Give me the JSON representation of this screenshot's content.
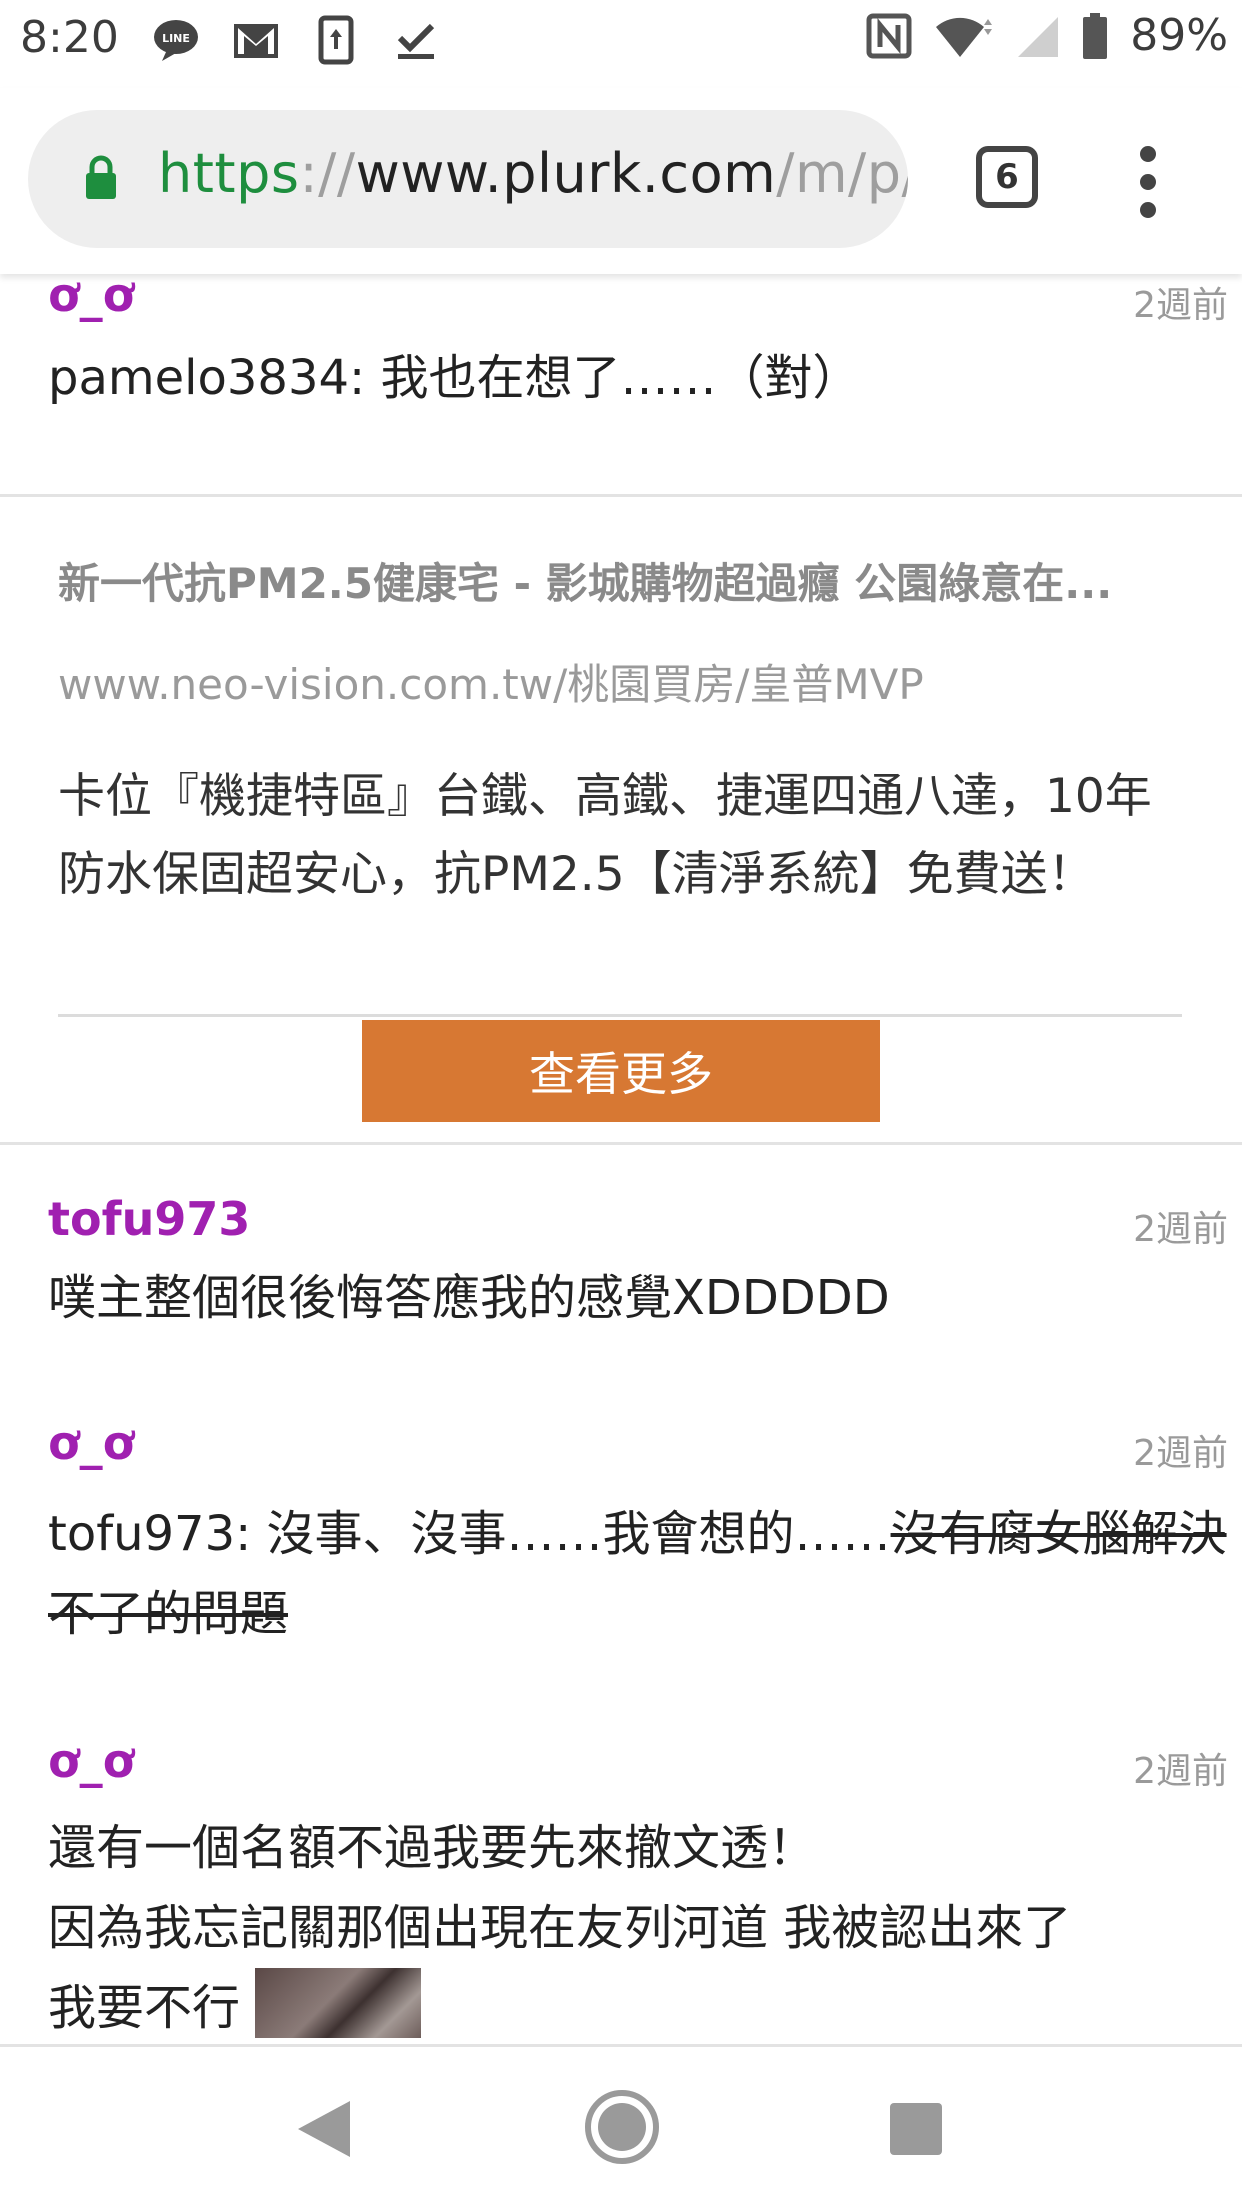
{
  "status_bar": {
    "time": "8:20",
    "battery": "89%",
    "left_icons": [
      "line-icon",
      "gmail-icon",
      "sync-icon",
      "check-download-icon"
    ],
    "right_icons": [
      "nfc-icon",
      "wifi-icon",
      "signal-icon",
      "battery-icon"
    ]
  },
  "browser": {
    "url_scheme": "https",
    "url_sep": "://",
    "url_host": "www.plurk.com",
    "url_path": "/m/p/r",
    "tab_count": "6",
    "accent_color": "#1e8e3e"
  },
  "responses": [
    {
      "username": "ơ_ơ",
      "timestamp": "2週前",
      "text": "pamelo3834: 我也在想了……（對）"
    },
    {
      "username": "tofu973",
      "timestamp": "2週前",
      "text": "噗主整個很後悔答應我的感覺XDDDDD"
    },
    {
      "username": "ơ_ơ",
      "timestamp": "2週前",
      "text": "tofu973: 沒事、沒事……我會想的……",
      "struck_text": "沒有腐女腦解決不了的問題"
    },
    {
      "username": "ơ_ơ",
      "timestamp": "2週前",
      "line1": "還有一個名額不過我要先來撤文透！",
      "line2": "因為我忘記關那個出現在友列河道 我被認出來了",
      "line3": "我要不行"
    }
  ],
  "ad": {
    "title": "新一代抗PM2.5健康宅 - 影城購物超過癮 公園綠意在...",
    "url": "www.neo-vision.com.tw/桃園買房/皇普MVP",
    "description": "卡位『機捷特區』台鐵、高鐵、捷運四通八達，10年防水保固超安心，抗PM2.5【清淨系統】免費送！",
    "button_label": "查看更多",
    "button_color": "#d77833"
  },
  "username_color": "#a020b0"
}
